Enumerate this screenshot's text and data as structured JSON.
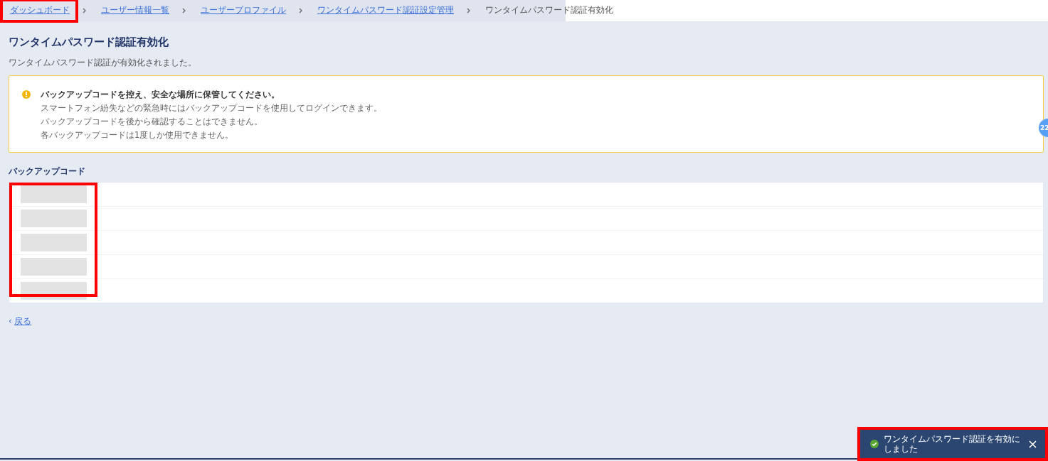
{
  "breadcrumbs": [
    {
      "label": "ダッシュボード",
      "link": true,
      "highlighted": true
    },
    {
      "label": "ユーザー情報一覧",
      "link": true,
      "highlighted": false
    },
    {
      "label": "ユーザープロファイル",
      "link": true,
      "highlighted": false
    },
    {
      "label": "ワンタイムパスワード認証設定管理",
      "link": true,
      "highlighted": false
    },
    {
      "label": "ワンタイムパスワード認証有効化",
      "link": false,
      "highlighted": false
    }
  ],
  "title": "ワンタイムパスワード認証有効化",
  "message": "ワンタイムパスワード認証が有効化されました。",
  "alert": {
    "heading": "バックアップコードを控え、安全な場所に保管してください。",
    "lines": [
      "スマートフォン紛失などの緊急時にはバックアップコードを使用してログインできます。",
      "バックアップコードを後から確認することはできません。",
      "各バックアップコードは1度しか使用できません。"
    ]
  },
  "badge": "22",
  "backup_codes": {
    "title": "バックアップコード",
    "highlighted": true,
    "rows": [
      {
        "kind": "redacted"
      },
      {
        "kind": "redacted"
      },
      {
        "kind": "redacted"
      },
      {
        "kind": "redacted"
      },
      {
        "kind": "redacted"
      }
    ]
  },
  "back_link": {
    "arrow": "‹",
    "label": "戻る"
  },
  "toast": {
    "message": "ワンタイムパスワード認証を有効にしました",
    "highlighted": true
  }
}
